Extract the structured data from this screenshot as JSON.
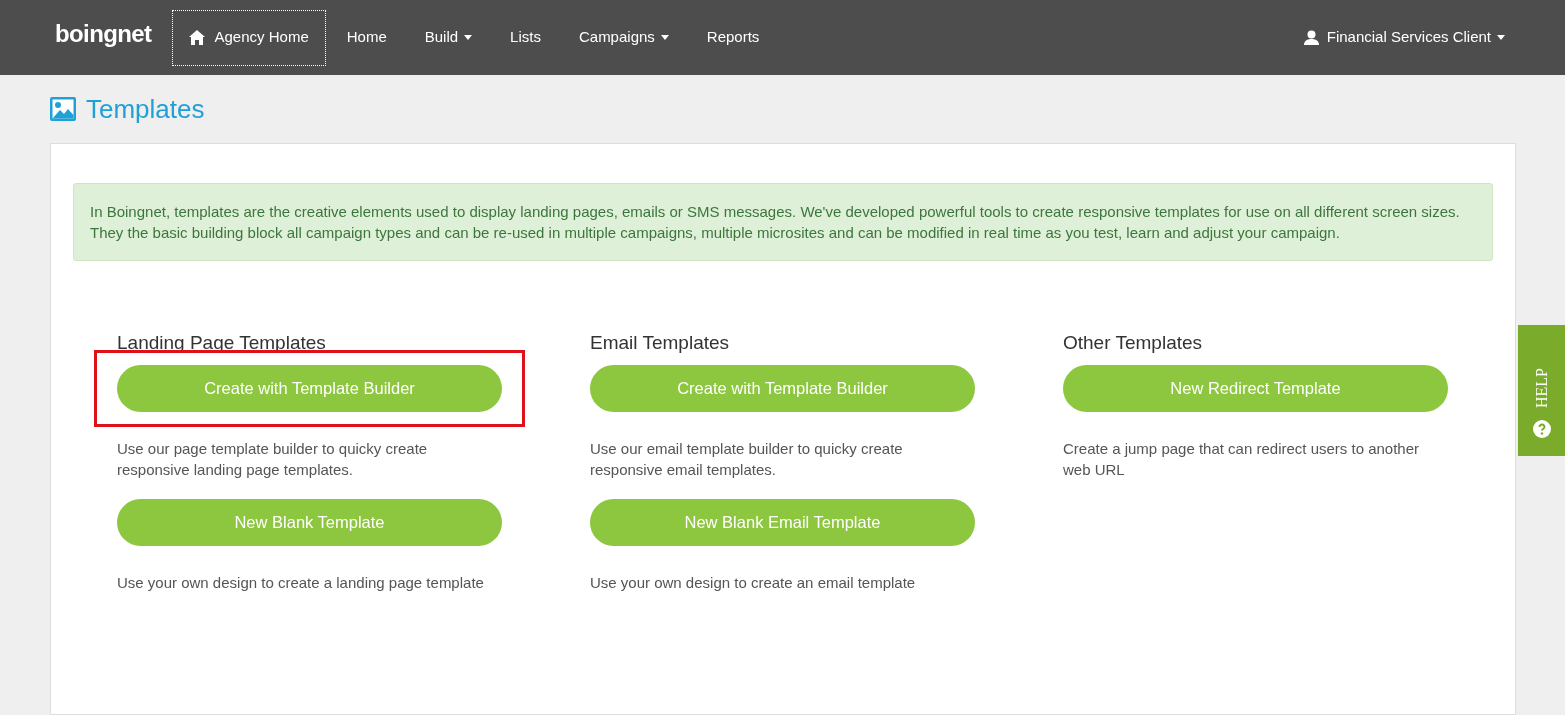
{
  "navbar": {
    "logo": "boingnet",
    "items": [
      {
        "label": "Agency Home",
        "kind": "home",
        "focused": true,
        "dropdown": false
      },
      {
        "label": "Home",
        "kind": "plain",
        "focused": false,
        "dropdown": false
      },
      {
        "label": "Build",
        "kind": "plain",
        "focused": false,
        "dropdown": true
      },
      {
        "label": "Lists",
        "kind": "plain",
        "focused": false,
        "dropdown": false
      },
      {
        "label": "Campaigns",
        "kind": "plain",
        "focused": false,
        "dropdown": true
      },
      {
        "label": "Reports",
        "kind": "plain",
        "focused": false,
        "dropdown": false
      }
    ],
    "user": {
      "label": "Financial Services Client",
      "dropdown": true
    }
  },
  "page_title": "Templates",
  "info": "In Boingnet, templates are the creative elements used to display landing pages, emails or SMS messages. We've developed powerful tools to create responsive templates for use on all different screen sizes. They the basic building block all campaign types and can be re-used in multiple campaigns, multiple microsites and can be modified in real time as you test, learn and adjust your campaign.",
  "sections": [
    {
      "heading": "Landing Page Templates",
      "actions": [
        {
          "button": "Create with Template Builder",
          "description": "Use our page template builder to quicky create responsive landing page templates.",
          "highlighted": true
        },
        {
          "button": "New Blank Template",
          "description": "Use your own design to create a landing page template",
          "highlighted": false
        }
      ]
    },
    {
      "heading": "Email Templates",
      "actions": [
        {
          "button": "Create with Template Builder",
          "description": "Use our email template builder to quicky create responsive email templates.",
          "highlighted": false
        },
        {
          "button": "New Blank Email Template",
          "description": "Use your own design to create an email template",
          "highlighted": false
        }
      ]
    },
    {
      "heading": "Other Templates",
      "actions": [
        {
          "button": "New Redirect Template",
          "description": "Create a jump page that can redirect users to another web URL",
          "highlighted": false
        }
      ]
    }
  ],
  "help_tab": "HELP"
}
